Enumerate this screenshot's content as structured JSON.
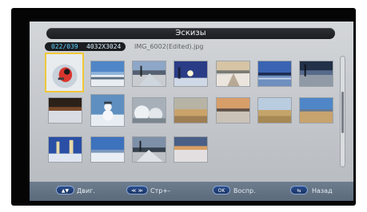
{
  "header": {
    "title": "Эскизы",
    "index": "022/039",
    "resolution": "4032X3024",
    "filename": "IMG_6002(Edited).jpg"
  },
  "thumbnails": [
    {
      "name": "thumb-1",
      "selected": true
    },
    {
      "name": "thumb-2"
    },
    {
      "name": "thumb-3"
    },
    {
      "name": "thumb-4"
    },
    {
      "name": "thumb-5"
    },
    {
      "name": "thumb-6"
    },
    {
      "name": "thumb-7"
    },
    {
      "name": "thumb-8"
    },
    {
      "name": "thumb-9"
    },
    {
      "name": "thumb-10"
    },
    {
      "name": "thumb-11"
    },
    {
      "name": "thumb-12"
    },
    {
      "name": "thumb-13"
    },
    {
      "name": "thumb-14"
    },
    {
      "name": "thumb-15"
    },
    {
      "name": "thumb-16"
    },
    {
      "name": "thumb-17"
    },
    {
      "name": "thumb-18"
    }
  ],
  "footer": {
    "move_key": "▲▼",
    "move_label": "Двиг.",
    "page_key": "≪ ≫",
    "page_label": "Стр+-",
    "ok_key": "OK",
    "ok_label": "Воспр.",
    "back_key": "⇆",
    "back_label": "Назад"
  },
  "colors": {
    "accent": "#5fd0ff",
    "selection": "#f0c83a"
  }
}
